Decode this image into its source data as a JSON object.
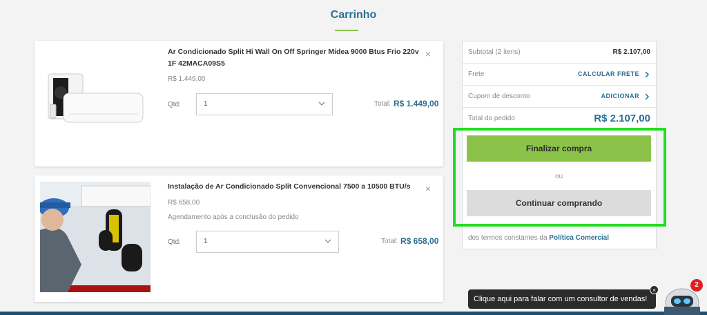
{
  "page": {
    "title": "Carrinho"
  },
  "items": [
    {
      "name": "Ar Condicionado Split Hi Wall On Off Springer Midea 9000 Btus Frio 220v 1F 42MACA09S5",
      "unit_price": "R$ 1.449,00",
      "note": "",
      "qty_label": "Qtd:",
      "qty": "1",
      "total_label": "Total:",
      "total": "R$ 1.449,00",
      "remove": "×",
      "image": "air-conditioner-product-image"
    },
    {
      "name": "Instalação de Ar Condicionado Split Convencional 7500 a 10500 BTU/s",
      "unit_price": "R$ 658,00",
      "note": "Agendamento após a conclusão do pedido",
      "qty_label": "Qtd:",
      "qty": "1",
      "total_label": "Total:",
      "total": "R$ 658,00",
      "remove": "×",
      "image": "technician-installation-image"
    }
  ],
  "summary": {
    "subtotal_label": "Subtotal (2 itens)",
    "subtotal_value": "R$ 2.107,00",
    "freight_label": "Frete",
    "freight_action": "CALCULAR FRETE",
    "coupon_label": "Cupom de desconto",
    "coupon_action": "ADICIONAR",
    "total_label": "Total do pedido",
    "total_value": "R$ 2.107,00"
  },
  "actions": {
    "finalize": "Finalizar compra",
    "or": "ou",
    "continue": "Continuar comprando"
  },
  "terms": {
    "prefix": "dos termos constantes da",
    "link": "Política Comercial"
  },
  "chat": {
    "message": "Clique aqui para falar com um consultor de vendas!",
    "close": "×",
    "badge": "2"
  },
  "colors": {
    "accent_blue": "#2a6f93",
    "finalize_green": "#8bc34a",
    "highlight_outline": "#22dd22",
    "bottom_bar": "#1d4f73"
  }
}
